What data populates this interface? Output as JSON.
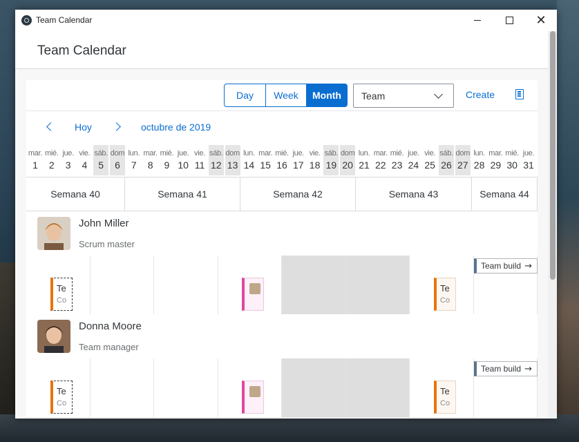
{
  "window": {
    "title": "Team Calendar"
  },
  "app": {
    "title": "Team Calendar"
  },
  "toolbar": {
    "views": [
      "Day",
      "Week",
      "Month"
    ],
    "selected_view": "Month",
    "filter_value": "Team",
    "create_label": "Create",
    "legend_icon": "legend-icon"
  },
  "nav": {
    "today_label": "Hoy",
    "month_label": "octubre de 2019"
  },
  "days": [
    {
      "n": "mar.",
      "d": "1"
    },
    {
      "n": "mié.",
      "d": "2"
    },
    {
      "n": "jue.",
      "d": "3"
    },
    {
      "n": "vie.",
      "d": "4"
    },
    {
      "n": "sáb.",
      "d": "5",
      "we": true
    },
    {
      "n": "dom",
      "d": "6",
      "we": true
    },
    {
      "n": "lun.",
      "d": "7"
    },
    {
      "n": "mar.",
      "d": "8"
    },
    {
      "n": "mié.",
      "d": "9"
    },
    {
      "n": "jue.",
      "d": "10"
    },
    {
      "n": "vie.",
      "d": "11"
    },
    {
      "n": "sáb.",
      "d": "12",
      "we": true
    },
    {
      "n": "dom",
      "d": "13",
      "we": true
    },
    {
      "n": "lun.",
      "d": "14"
    },
    {
      "n": "mar.",
      "d": "15"
    },
    {
      "n": "mié.",
      "d": "16"
    },
    {
      "n": "jue.",
      "d": "17"
    },
    {
      "n": "vie.",
      "d": "18"
    },
    {
      "n": "sáb.",
      "d": "19",
      "we": true
    },
    {
      "n": "dom",
      "d": "20",
      "we": true
    },
    {
      "n": "lun.",
      "d": "21"
    },
    {
      "n": "mar.",
      "d": "22"
    },
    {
      "n": "mié.",
      "d": "23"
    },
    {
      "n": "jue.",
      "d": "24"
    },
    {
      "n": "vie.",
      "d": "25"
    },
    {
      "n": "sáb.",
      "d": "26",
      "we": true
    },
    {
      "n": "dom",
      "d": "27",
      "we": true
    },
    {
      "n": "lun.",
      "d": "28"
    },
    {
      "n": "mar.",
      "d": "29"
    },
    {
      "n": "mié.",
      "d": "30"
    },
    {
      "n": "jue.",
      "d": "31"
    }
  ],
  "weeks": [
    "Semana 40",
    "Semana 41",
    "Semana 42",
    "Semana 43",
    "Semana 44"
  ],
  "people": [
    {
      "name": "John Miller",
      "role": "Scrum master",
      "appointments": [
        {
          "style": "tent",
          "t1": "Te",
          "t2": "Co"
        },
        {
          "style": "pink",
          "avatar": true
        },
        {
          "style": "orange",
          "t1": "Te",
          "t2": "Co"
        }
      ],
      "blocker": "Team build"
    },
    {
      "name": "Donna Moore",
      "role": "Team manager",
      "appointments": [
        {
          "style": "tent",
          "t1": "Te",
          "t2": "Co"
        },
        {
          "style": "pink",
          "avatar": true
        },
        {
          "style": "orange",
          "t1": "Te",
          "t2": "Co"
        }
      ],
      "blocker": "Team build"
    }
  ],
  "colors": {
    "accent": "#0a6ed1",
    "tentative": "#e9730c",
    "pink": "#df479f",
    "blocker": "#5b738b",
    "weekend": "#e5e5e5"
  }
}
